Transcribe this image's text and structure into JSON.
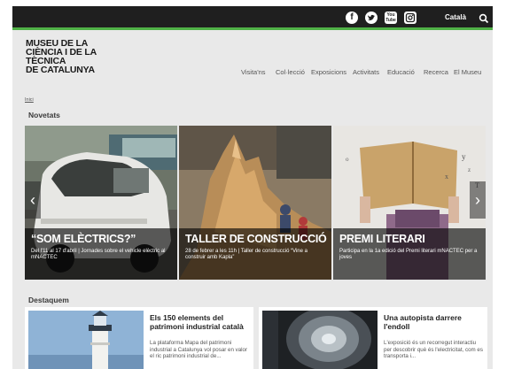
{
  "topbar": {
    "social": [
      {
        "icon": "facebook-icon",
        "glyph": "f"
      },
      {
        "icon": "twitter-icon",
        "glyph": "t"
      },
      {
        "icon": "youtube-icon",
        "glyph": "You Tube"
      },
      {
        "icon": "instagram-icon",
        "glyph": ""
      }
    ],
    "language": "Català",
    "search_icon": "search-icon",
    "accent_color": "#4fb146",
    "bar_color": "#1f1f1f"
  },
  "logo": {
    "lines": [
      "MUSEU DE LA",
      "CIÈNCIA I DE LA",
      "TÈCNICA",
      "DE CATALUNYA"
    ]
  },
  "nav": [
    "Visita'ns",
    "Col·lecció",
    "Exposicions",
    "Activitats",
    "Educació",
    "Recerca",
    "El Museu"
  ],
  "breadcrumb": "Inici",
  "novetats": {
    "title": "Novetats",
    "slides": [
      {
        "title": "“SOM ELÈCTRICS?”",
        "text": "Del l'11 al 17 d'abril | Jornades sobre el vehicle elèctric al mNACTEC"
      },
      {
        "title": "TALLER DE CONSTRUCCIÓ",
        "text": "28 de febrer a les 11h | Taller de construcció “Vine a construir amb Kapla”"
      },
      {
        "title": "PREMI LITERARI",
        "text": "Participa en la 1a edició del Premi literari mNACTEC per a joves"
      }
    ],
    "prev_glyph": "‹",
    "next_glyph": "›"
  },
  "destaquem": {
    "title": "Destaquem",
    "cards": [
      {
        "title": "Els 150 elements del patrimoni industrial català",
        "text": "La plataforma Mapa del patrimoni industrial a Catalunya vol posar en valor el ric patrimoni industrial de..."
      },
      {
        "title": "Una autopista darrere l'endoll",
        "text": "L'exposició és un recorregut interactiu per descobrir què és l'electricitat, com es transporta i..."
      }
    ]
  }
}
